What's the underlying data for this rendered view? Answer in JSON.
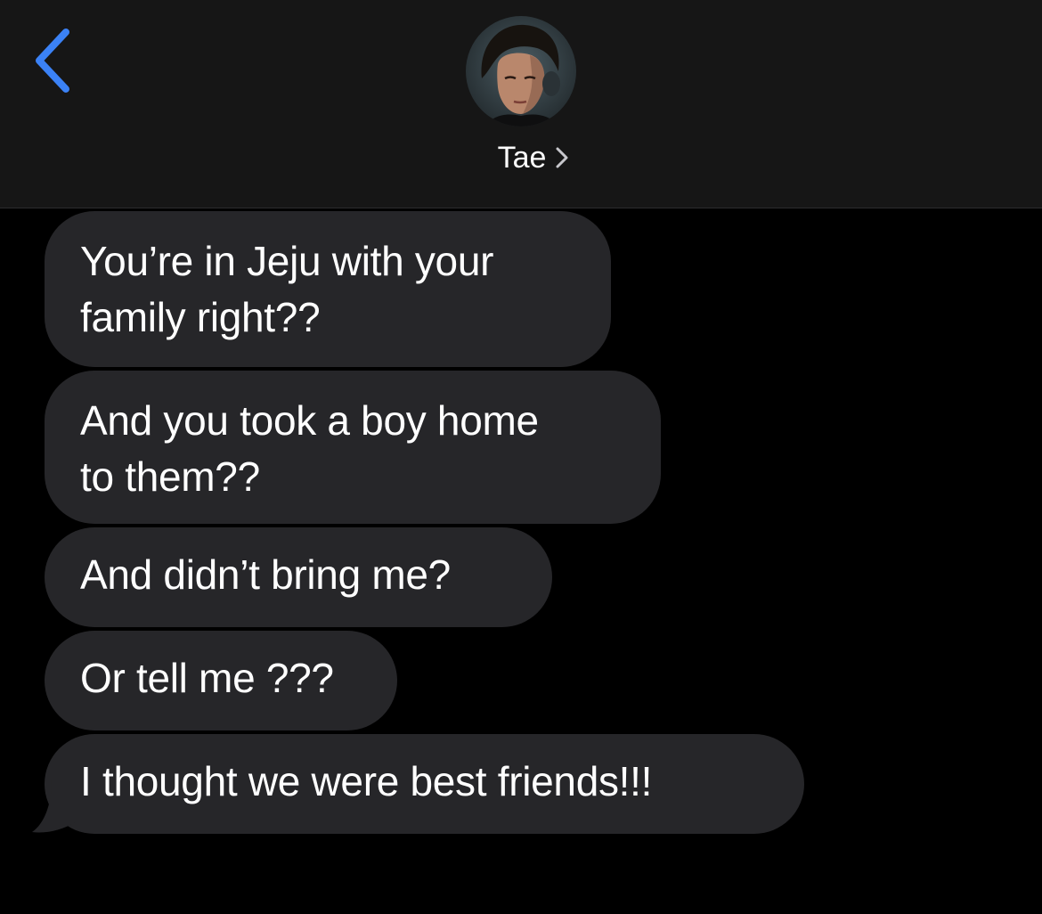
{
  "header": {
    "contact_name": "Tae",
    "back_icon": "chevron-left-icon",
    "detail_icon": "chevron-right-icon",
    "accent_color": "#3b82f6"
  },
  "messages": [
    {
      "text": "You’re in Jeju with your\nfamily right??"
    },
    {
      "text": "And you took a boy home\nto them??"
    },
    {
      "text": "And didn’t bring me?"
    },
    {
      "text": "Or tell me ???"
    },
    {
      "text": "I thought we were best friends!!!"
    }
  ],
  "colors": {
    "background": "#000000",
    "header_background": "#161616",
    "incoming_bubble": "#262629",
    "text": "#ffffff"
  }
}
